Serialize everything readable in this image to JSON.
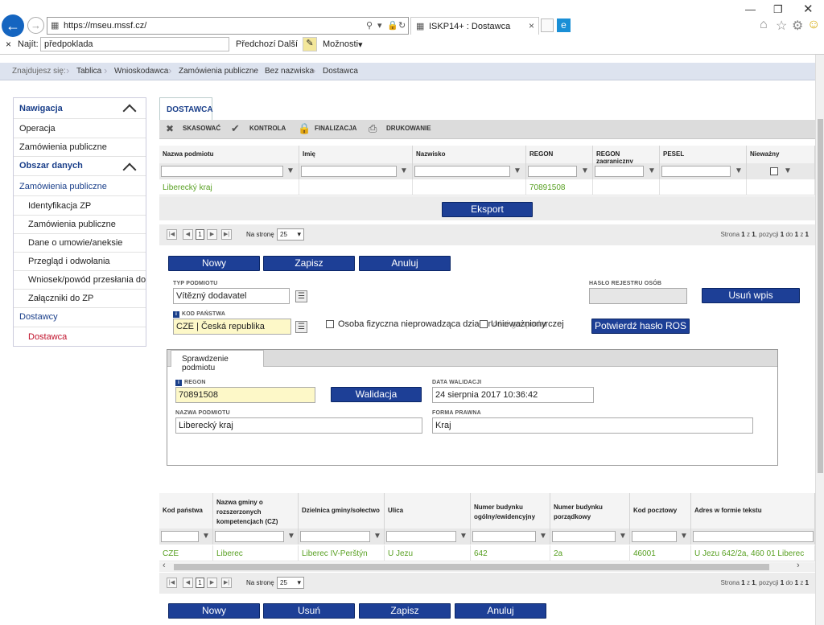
{
  "browser": {
    "url": "https://mseu.mssf.cz/",
    "url_host_highlight": "mssf.cz",
    "tab_title": "ISKP14+ : Dostawca",
    "find_label": "Najít:",
    "find_value": "předpoklada",
    "find_prev": "Předchozí",
    "find_next": "Další",
    "find_options": "Možnosti"
  },
  "breadcrumb": {
    "lead": "Znajdujesz się:",
    "items": [
      "Tablica",
      "Wnioskodawca",
      "Zamówienia publiczne",
      "Bez nazwiska",
      "Dostawca"
    ]
  },
  "sidebar": {
    "nav_title": "Nawigacja",
    "items": [
      {
        "label": "Operacja",
        "kind": "item"
      },
      {
        "label": "Zamówienia publiczne",
        "kind": "item"
      },
      {
        "label": "Obszar danych",
        "kind": "head"
      },
      {
        "label": "Zamówienia publiczne",
        "kind": "sub-head"
      },
      {
        "label": "Identyfikacja ZP",
        "kind": "sub"
      },
      {
        "label": "Zamówienia publiczne",
        "kind": "sub"
      },
      {
        "label": "Dane o umowie/aneksie",
        "kind": "sub"
      },
      {
        "label": "Przegląd i odwołania",
        "kind": "sub"
      },
      {
        "label": "Wniosek/powód przesłania do UOKiK",
        "kind": "sub"
      },
      {
        "label": "Załączniki do ZP",
        "kind": "sub"
      },
      {
        "label": "Dostawcy",
        "kind": "sub-head"
      },
      {
        "label": "Dostawca",
        "kind": "active"
      }
    ]
  },
  "main": {
    "tab_title": "DOSTAWCA",
    "toolbar": {
      "cancel": "SKASOWAĆ",
      "check": "KONTROLA",
      "finalize": "FINALIZACJA",
      "print": "DRUKOWANIE"
    },
    "grid1": {
      "columns": [
        "Nazwa podmiotu",
        "Imię",
        "Nazwisko",
        "REGON",
        "REGON zagraniczny",
        "PESEL",
        "Nieważny"
      ],
      "row": [
        "Liberecký kraj",
        "",
        "",
        "70891508",
        "",
        "",
        ""
      ]
    },
    "export_label": "Eksport",
    "pager1": {
      "page": "1",
      "per_page_label": "Na stronę",
      "per_page": "25",
      "info_prefix": "Strona",
      "page_num": "1",
      "of": "z",
      "total_pages": "1",
      "items_label": ", pozycji",
      "from": "1",
      "to_word": "do",
      "to": "1",
      "of2": "z",
      "total": "1"
    },
    "buttons1": {
      "new": "Nowy",
      "save": "Zapisz",
      "cancel": "Anuluj"
    },
    "form": {
      "typ_label": "TYP PODMIOTU",
      "typ_value": "Vítězný dodavatel",
      "haslo_label": "HASŁO REJESTRU OSÓB",
      "remove_btn": "Usuń wpis",
      "kod_label": "KOD PAŃSTWA",
      "kod_value": "CZE | Česká republika",
      "osoba_label": "Osoba fizyczna nieprowadząca działalności gospodarczej",
      "osoba_overlay": "Unieważniony",
      "confirm_btn": "Potwierdź hasło ROS"
    },
    "check": {
      "tab": "Sprawdzenie podmiotu",
      "regon_label": "REGON",
      "regon_value": "70891508",
      "validate_btn": "Walidacja",
      "date_label": "DATA WALIDACJI",
      "date_value": "24 sierpnia 2017 10:36:42",
      "name_label": "NAZWA PODMIOTU",
      "name_value": "Liberecký kraj",
      "form_label": "FORMA PRAWNA",
      "form_value": "Kraj"
    },
    "grid2": {
      "columns": [
        "Kod państwa",
        "Nazwa gminy o rozszerzonych kompetencjach (CZ)",
        "Dzielnica gminy/sołectwo",
        "Ulica",
        "Numer budynku ogólny/ewidencyjny",
        "Numer budynku porządkowy",
        "Kod pocztowy",
        "Adres w formie tekstu"
      ],
      "row": [
        "CZE",
        "Liberec",
        "Liberec IV-Perštýn",
        "U Jezu",
        "642",
        "2a",
        "46001",
        "U Jezu 642/2a, 460 01 Liberec"
      ]
    },
    "pager2": {
      "page": "1",
      "per_page_label": "Na stronę",
      "per_page": "25",
      "info_prefix": "Strona",
      "page_num": "1",
      "of": "z",
      "total_pages": "1",
      "items_label": ", pozycji",
      "from": "1",
      "to_word": "do",
      "to": "1",
      "of2": "z",
      "total": "1"
    },
    "buttons2": {
      "new": "Nowy",
      "delete": "Usuń",
      "save": "Zapisz",
      "cancel": "Anuluj"
    }
  },
  "colors": {
    "accent": "#1d3f96",
    "link_green": "#58a022",
    "active_red": "#c0102a",
    "breadcrumb_bg": "#dde3ef"
  }
}
